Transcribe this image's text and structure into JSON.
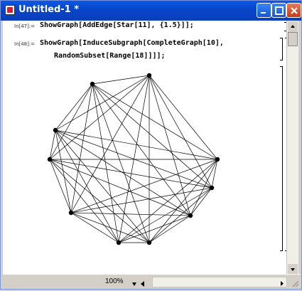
{
  "window": {
    "title": "Untitled-1 *",
    "icon": "mathematica-notebook-icon",
    "accent": "#0a58e6"
  },
  "cells": [
    {
      "label": "In[47]:=",
      "lines": [
        "ShowGraph[AddEdge[Star[11], {1.5}]];"
      ]
    },
    {
      "label": "In[48]:=",
      "lines": [
        "ShowGraph[InduceSubgraph[CompleteGraph[10],",
        "RandomSubset[Range[18]]]];"
      ]
    }
  ],
  "graph": {
    "vertex_count": 10
  },
  "statusbar": {
    "zoom": "100%"
  }
}
